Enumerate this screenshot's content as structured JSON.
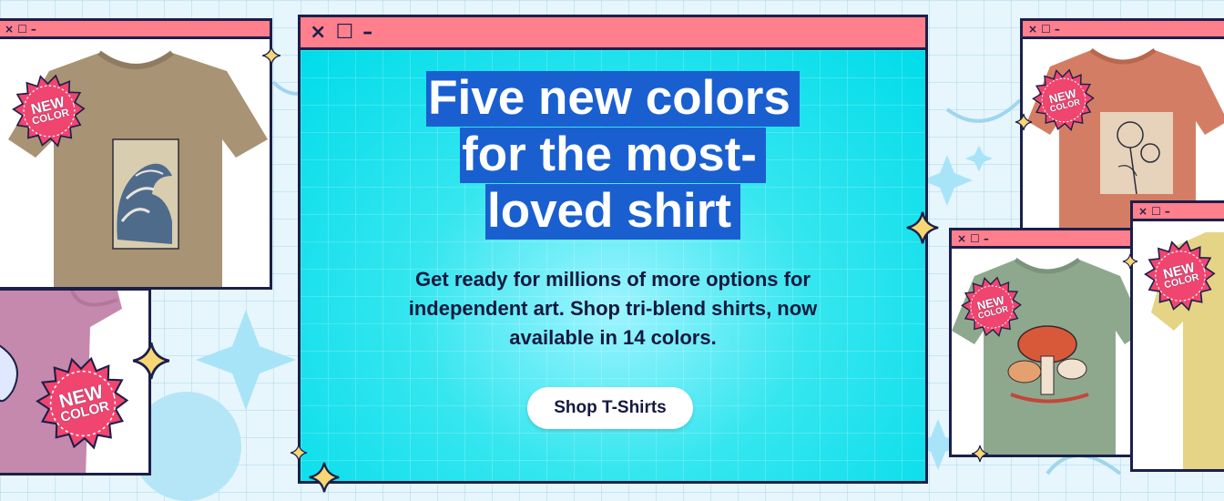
{
  "hero": {
    "window_controls": [
      "×",
      "☐",
      "–"
    ],
    "headline_lines": [
      "Five new colors",
      "for the most-",
      "loved shirt"
    ],
    "subtext": "Get ready for millions of more options for independent art. Shop tri-blend shirts, now available in 14 colors.",
    "cta_label": "Shop T-Shirts"
  },
  "badge": {
    "line1": "NEW",
    "line2": "COLOR"
  },
  "small_window_controls": [
    "×",
    "☐",
    "–"
  ],
  "products": [
    {
      "name": "tan-wave-tshirt",
      "shirt_color": "#a89374",
      "art": "wave-print"
    },
    {
      "name": "pink-tshirt",
      "shirt_color": "#c589ad",
      "art": "partial"
    },
    {
      "name": "terracotta-floral-tshirt",
      "shirt_color": "#d37e64",
      "art": "floral-sketch"
    },
    {
      "name": "sage-mushroom-tshirt",
      "shirt_color": "#8ea88e",
      "art": "mushrooms"
    },
    {
      "name": "yellow-tshirt",
      "shirt_color": "#e5d486",
      "art": "partial"
    }
  ],
  "colors": {
    "titlebar": "#ff7f8d",
    "outline": "#1c1f4a",
    "hero_bg": "#00dcea",
    "headline_highlight": "#1a5fd0",
    "badge": "#f0456f",
    "star": "#f7d774",
    "page_bg": "#e6f6fc"
  }
}
